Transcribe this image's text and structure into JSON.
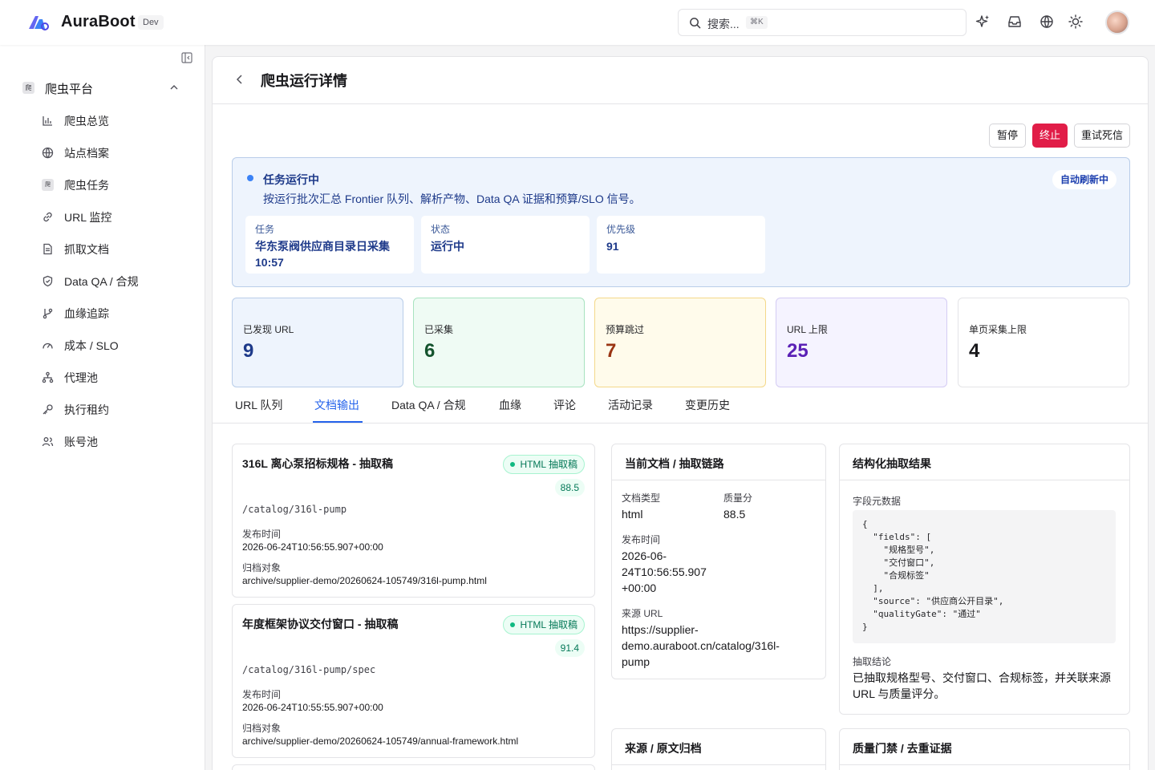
{
  "header": {
    "brand": "AuraBoot",
    "env": "Dev",
    "search_placeholder": "搜索...",
    "search_shortcut": "⌘K"
  },
  "sidebar": {
    "group": {
      "label": "爬虫平台",
      "icon_text": "爬"
    },
    "items": [
      {
        "label": "爬虫总览",
        "icon": "bar-chart-icon"
      },
      {
        "label": "站点档案",
        "icon": "globe-icon"
      },
      {
        "label": "爬虫任务",
        "icon": "crawler-task-icon",
        "icon_text": "爬"
      },
      {
        "label": "URL 监控",
        "icon": "link-icon"
      },
      {
        "label": "抓取文档",
        "icon": "document-icon"
      },
      {
        "label": "Data QA / 合规",
        "icon": "shield-icon"
      },
      {
        "label": "血缘追踪",
        "icon": "git-branch-icon"
      },
      {
        "label": "成本 / SLO",
        "icon": "gauge-icon"
      },
      {
        "label": "代理池",
        "icon": "network-icon"
      },
      {
        "label": "执行租约",
        "icon": "key-icon"
      },
      {
        "label": "账号池",
        "icon": "users-icon"
      }
    ]
  },
  "page": {
    "title": "爬虫运行详情",
    "actions": {
      "pause": "暂停",
      "stop": "终止",
      "retry": "重试死信"
    }
  },
  "status": {
    "title": "任务运行中",
    "description": "按运行批次汇总 Frontier 队列、解析产物、Data QA 证据和预算/SLO 信号。",
    "auto_refresh": "自动刷新中",
    "fields": [
      {
        "label": "任务",
        "value": "华东泵阀供应商目录日采集 10:57"
      },
      {
        "label": "状态",
        "value": "运行中"
      },
      {
        "label": "优先级",
        "value": "91"
      }
    ]
  },
  "stats": [
    {
      "label": "已发现 URL",
      "value": "9"
    },
    {
      "label": "已采集",
      "value": "6"
    },
    {
      "label": "预算跳过",
      "value": "7"
    },
    {
      "label": "URL 上限",
      "value": "25"
    },
    {
      "label": "单页采集上限",
      "value": "4"
    }
  ],
  "tabs": [
    "URL 队列",
    "文档输出",
    "Data QA / 合规",
    "血缘",
    "评论",
    "活动记录",
    "变更历史"
  ],
  "active_tab": "文档输出",
  "documents": [
    {
      "title": "316L 离心泵招标规格 - 抽取稿",
      "badge": "HTML 抽取稿",
      "score": "88.5",
      "path": "/catalog/316l-pump",
      "published_label": "发布时间",
      "published": "2026-06-24T10:56:55.907+00:00",
      "archive_label": "归档对象",
      "archive": "archive/supplier-demo/20260624-105749/316l-pump.html"
    },
    {
      "title": "年度框架协议交付窗口 - 抽取稿",
      "badge": "HTML 抽取稿",
      "score": "91.4",
      "path": "/catalog/316l-pump/spec",
      "published_label": "发布时间",
      "published": "2026-06-24T10:55:55.907+00:00",
      "archive_label": "归档对象",
      "archive": "archive/supplier-demo/20260624-105749/annual-framework.html"
    }
  ],
  "current_doc": {
    "title": "当前文档 / 抽取链路",
    "type_label": "文档类型",
    "type": "html",
    "quality_label": "质量分",
    "quality": "88.5",
    "published_label": "发布时间",
    "published_lines": [
      "2026-06-",
      "24T10:56:55.907",
      "+00:00"
    ],
    "source_label": "来源 URL",
    "source_lines": [
      "https://supplier-",
      "demo.auraboot.cn/catalog/316l-",
      "pump"
    ]
  },
  "structured": {
    "title": "结构化抽取结果",
    "meta_label": "字段元数据",
    "code_lines": [
      "{",
      "  \"fields\": [",
      "    \"规格型号\",",
      "    \"交付窗口\",",
      "    \"合规标签\"",
      "  ],",
      "  \"source\": \"供应商公开目录\",",
      "  \"qualityGate\": \"通过\"",
      "}"
    ],
    "conclusion_label": "抽取结论",
    "conclusion_lines": [
      "已抽取规格型号、交付窗口、合规标签，并关联来源",
      "URL 与质量评分。"
    ]
  },
  "bottom_cards": [
    "来源 / 原文归档",
    "质量门禁 / 去重证据"
  ],
  "colors": {
    "accent": "#2563eb",
    "danger": "#e11d48",
    "stat_blue": "#1e3a8a",
    "stat_green": "#14532d",
    "stat_amber": "#9a3412",
    "stat_purple": "#5b21b6",
    "stat_neutral": "#18181b"
  }
}
